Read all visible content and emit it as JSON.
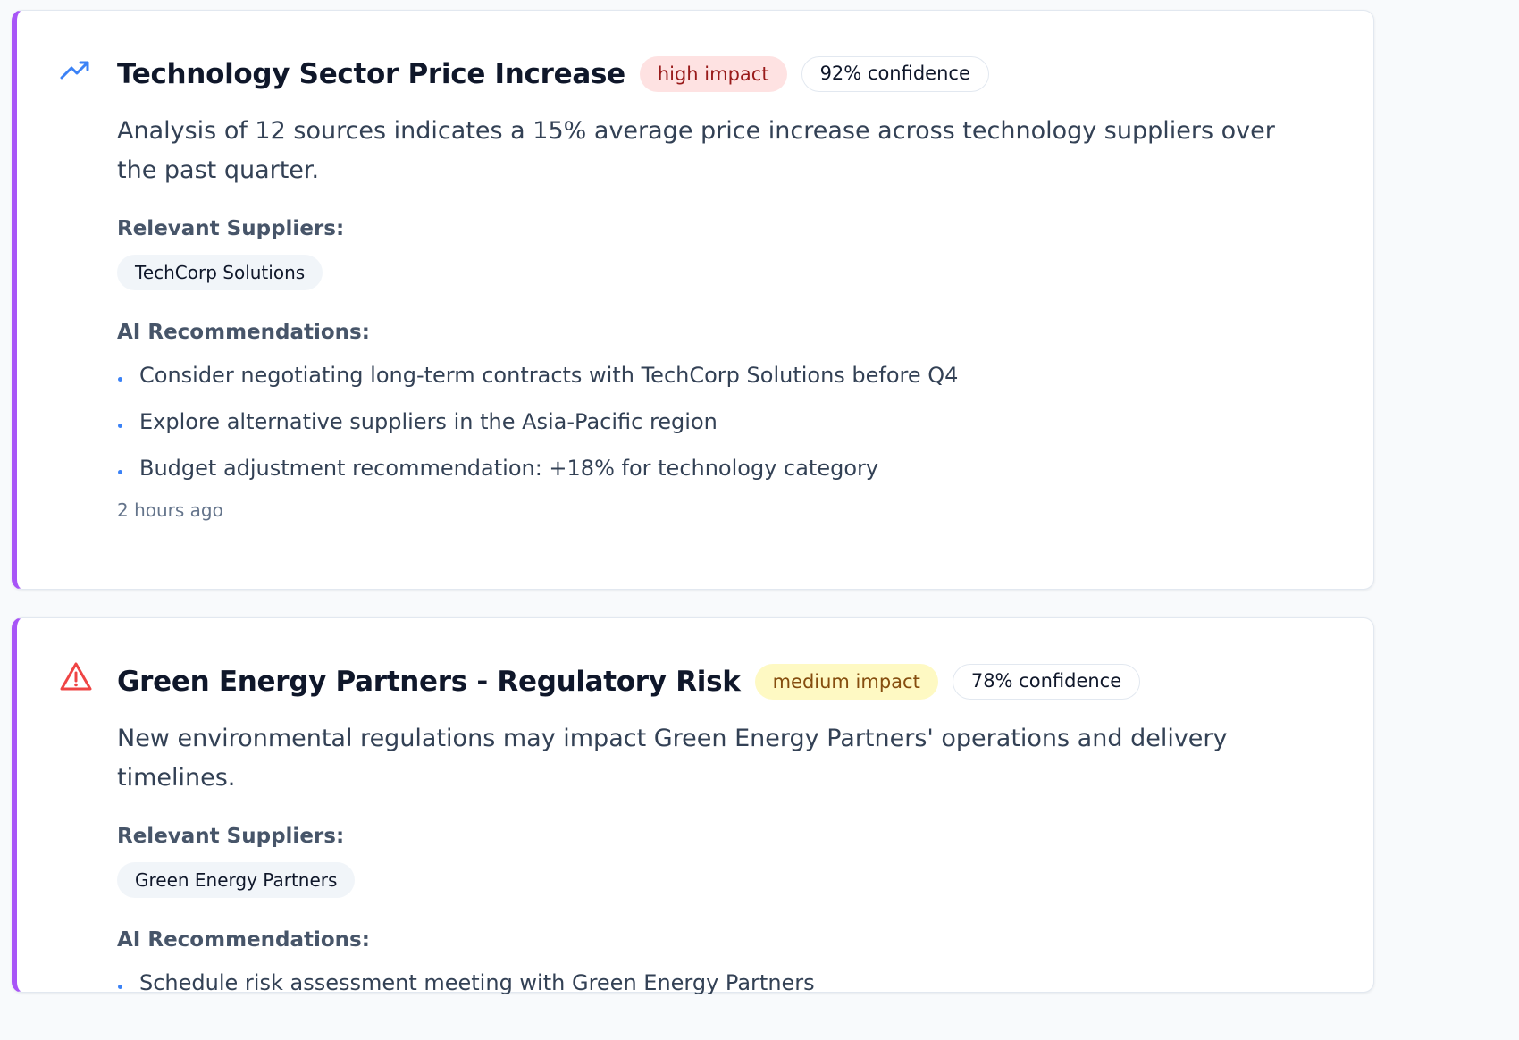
{
  "colors": {
    "accent_border": "#a855f7",
    "high_impact_bg": "#fee2e2",
    "high_impact_text": "#991b1b",
    "medium_impact_bg": "#fef9c3",
    "medium_impact_text": "#854d0e",
    "trend_icon": "#3b82f6",
    "warning_icon": "#ef4444",
    "bullet": "#3b82f6"
  },
  "insights": [
    {
      "icon": "trending-up-icon",
      "title": "Technology Sector Price Increase",
      "impact": "high impact",
      "confidence": "92% confidence",
      "description": "Analysis of 12 sources indicates a 15% average price increase across technology suppliers over the past quarter.",
      "suppliers_label": "Relevant Suppliers:",
      "suppliers": [
        "TechCorp Solutions"
      ],
      "recommendations_label": "AI Recommendations:",
      "recommendations": [
        "Consider negotiating long-term contracts with TechCorp Solutions before Q4",
        "Explore alternative suppliers in the Asia-Pacific region",
        "Budget adjustment recommendation: +18% for technology category"
      ],
      "timestamp": "2 hours ago"
    },
    {
      "icon": "alert-triangle-icon",
      "title": "Green Energy Partners - Regulatory Risk",
      "impact": "medium impact",
      "confidence": "78% confidence",
      "description": "New environmental regulations may impact Green Energy Partners' operations and delivery timelines.",
      "suppliers_label": "Relevant Suppliers:",
      "suppliers": [
        "Green Energy Partners"
      ],
      "recommendations_label": "AI Recommendations:",
      "recommendations": [
        "Schedule risk assessment meeting with Green Energy Partners"
      ]
    }
  ]
}
